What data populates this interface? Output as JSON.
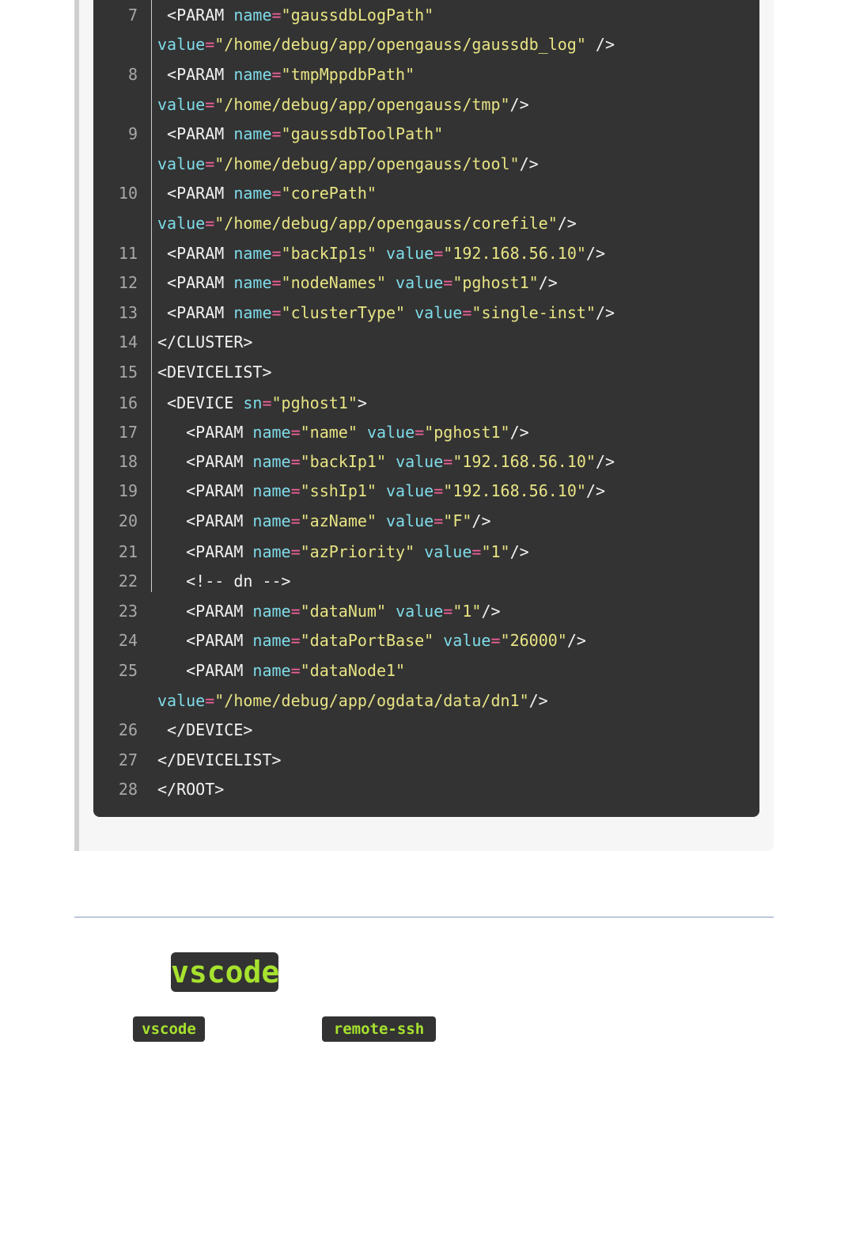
{
  "code_block": {
    "language": "xml",
    "lines": [
      {
        "num": "7",
        "segments": [
          {
            "t": "p",
            "v": " <PARAM "
          },
          {
            "t": "k",
            "v": "name"
          },
          {
            "t": "e",
            "v": "="
          },
          {
            "t": "s",
            "v": "\"gaussdbLogPath\""
          }
        ]
      },
      {
        "num": "",
        "segments": [
          {
            "t": "k",
            "v": "value"
          },
          {
            "t": "e",
            "v": "="
          },
          {
            "t": "s",
            "v": "\"/home/debug/app/opengauss/gaussdb_log\""
          },
          {
            "t": "p",
            "v": " />"
          }
        ]
      },
      {
        "num": "8",
        "segments": [
          {
            "t": "p",
            "v": " <PARAM "
          },
          {
            "t": "k",
            "v": "name"
          },
          {
            "t": "e",
            "v": "="
          },
          {
            "t": "s",
            "v": "\"tmpMppdbPath\""
          }
        ]
      },
      {
        "num": "",
        "segments": [
          {
            "t": "k",
            "v": "value"
          },
          {
            "t": "e",
            "v": "="
          },
          {
            "t": "s",
            "v": "\"/home/debug/app/opengauss/tmp\""
          },
          {
            "t": "p",
            "v": "/>"
          }
        ]
      },
      {
        "num": "9",
        "segments": [
          {
            "t": "p",
            "v": " <PARAM "
          },
          {
            "t": "k",
            "v": "name"
          },
          {
            "t": "e",
            "v": "="
          },
          {
            "t": "s",
            "v": "\"gaussdbToolPath\""
          }
        ]
      },
      {
        "num": "",
        "segments": [
          {
            "t": "k",
            "v": "value"
          },
          {
            "t": "e",
            "v": "="
          },
          {
            "t": "s",
            "v": "\"/home/debug/app/opengauss/tool\""
          },
          {
            "t": "p",
            "v": "/>"
          }
        ]
      },
      {
        "num": "10",
        "segments": [
          {
            "t": "p",
            "v": " <PARAM "
          },
          {
            "t": "k",
            "v": "name"
          },
          {
            "t": "e",
            "v": "="
          },
          {
            "t": "s",
            "v": "\"corePath\""
          }
        ]
      },
      {
        "num": "",
        "segments": [
          {
            "t": "k",
            "v": "value"
          },
          {
            "t": "e",
            "v": "="
          },
          {
            "t": "s",
            "v": "\"/home/debug/app/opengauss/corefile\""
          },
          {
            "t": "p",
            "v": "/>"
          }
        ]
      },
      {
        "num": "11",
        "segments": [
          {
            "t": "p",
            "v": " <PARAM "
          },
          {
            "t": "k",
            "v": "name"
          },
          {
            "t": "e",
            "v": "="
          },
          {
            "t": "s",
            "v": "\"backIp1s\""
          },
          {
            "t": "p",
            "v": " "
          },
          {
            "t": "k",
            "v": "value"
          },
          {
            "t": "e",
            "v": "="
          },
          {
            "t": "s",
            "v": "\"192.168.56.10\""
          },
          {
            "t": "p",
            "v": "/>"
          }
        ]
      },
      {
        "num": "12",
        "segments": [
          {
            "t": "p",
            "v": " <PARAM "
          },
          {
            "t": "k",
            "v": "name"
          },
          {
            "t": "e",
            "v": "="
          },
          {
            "t": "s",
            "v": "\"nodeNames\""
          },
          {
            "t": "p",
            "v": " "
          },
          {
            "t": "k",
            "v": "value"
          },
          {
            "t": "e",
            "v": "="
          },
          {
            "t": "s",
            "v": "\"pghost1\""
          },
          {
            "t": "p",
            "v": "/>"
          }
        ]
      },
      {
        "num": "13",
        "segments": [
          {
            "t": "p",
            "v": " <PARAM "
          },
          {
            "t": "k",
            "v": "name"
          },
          {
            "t": "e",
            "v": "="
          },
          {
            "t": "s",
            "v": "\"clusterType\""
          },
          {
            "t": "p",
            "v": " "
          },
          {
            "t": "k",
            "v": "value"
          },
          {
            "t": "e",
            "v": "="
          },
          {
            "t": "s",
            "v": "\"single-inst\""
          },
          {
            "t": "p",
            "v": "/>"
          }
        ]
      },
      {
        "num": "14",
        "segments": [
          {
            "t": "p",
            "v": "</CLUSTER>"
          }
        ]
      },
      {
        "num": "15",
        "segments": [
          {
            "t": "p",
            "v": "<DEVICELIST>"
          }
        ]
      },
      {
        "num": "16",
        "segments": [
          {
            "t": "p",
            "v": " <DEVICE "
          },
          {
            "t": "k",
            "v": "sn"
          },
          {
            "t": "e",
            "v": "="
          },
          {
            "t": "s",
            "v": "\"pghost1\""
          },
          {
            "t": "p",
            "v": ">"
          }
        ]
      },
      {
        "num": "17",
        "segments": [
          {
            "t": "p",
            "v": "   <PARAM "
          },
          {
            "t": "k",
            "v": "name"
          },
          {
            "t": "e",
            "v": "="
          },
          {
            "t": "s",
            "v": "\"name\""
          },
          {
            "t": "p",
            "v": " "
          },
          {
            "t": "k",
            "v": "value"
          },
          {
            "t": "e",
            "v": "="
          },
          {
            "t": "s",
            "v": "\"pghost1\""
          },
          {
            "t": "p",
            "v": "/>"
          }
        ]
      },
      {
        "num": "18",
        "segments": [
          {
            "t": "p",
            "v": "   <PARAM "
          },
          {
            "t": "k",
            "v": "name"
          },
          {
            "t": "e",
            "v": "="
          },
          {
            "t": "s",
            "v": "\"backIp1\""
          },
          {
            "t": "p",
            "v": " "
          },
          {
            "t": "k",
            "v": "value"
          },
          {
            "t": "e",
            "v": "="
          },
          {
            "t": "s",
            "v": "\"192.168.56.10\""
          },
          {
            "t": "p",
            "v": "/>"
          }
        ]
      },
      {
        "num": "19",
        "segments": [
          {
            "t": "p",
            "v": "   <PARAM "
          },
          {
            "t": "k",
            "v": "name"
          },
          {
            "t": "e",
            "v": "="
          },
          {
            "t": "s",
            "v": "\"sshIp1\""
          },
          {
            "t": "p",
            "v": " "
          },
          {
            "t": "k",
            "v": "value"
          },
          {
            "t": "e",
            "v": "="
          },
          {
            "t": "s",
            "v": "\"192.168.56.10\""
          },
          {
            "t": "p",
            "v": "/>"
          }
        ]
      },
      {
        "num": "20",
        "segments": [
          {
            "t": "p",
            "v": "   <PARAM "
          },
          {
            "t": "k",
            "v": "name"
          },
          {
            "t": "e",
            "v": "="
          },
          {
            "t": "s",
            "v": "\"azName\""
          },
          {
            "t": "p",
            "v": " "
          },
          {
            "t": "k",
            "v": "value"
          },
          {
            "t": "e",
            "v": "="
          },
          {
            "t": "s",
            "v": "\"F\""
          },
          {
            "t": "p",
            "v": "/>"
          }
        ]
      },
      {
        "num": "21",
        "segments": [
          {
            "t": "p",
            "v": "   <PARAM "
          },
          {
            "t": "k",
            "v": "name"
          },
          {
            "t": "e",
            "v": "="
          },
          {
            "t": "s",
            "v": "\"azPriority\""
          },
          {
            "t": "p",
            "v": " "
          },
          {
            "t": "k",
            "v": "value"
          },
          {
            "t": "e",
            "v": "="
          },
          {
            "t": "s",
            "v": "\"1\""
          },
          {
            "t": "p",
            "v": "/>"
          }
        ]
      },
      {
        "num": "22",
        "segments": [
          {
            "t": "p",
            "v": "   <!-- dn -->"
          }
        ]
      },
      {
        "num": "23",
        "segments": [
          {
            "t": "p",
            "v": "   <PARAM "
          },
          {
            "t": "k",
            "v": "name"
          },
          {
            "t": "e",
            "v": "="
          },
          {
            "t": "s",
            "v": "\"dataNum\""
          },
          {
            "t": "p",
            "v": " "
          },
          {
            "t": "k",
            "v": "value"
          },
          {
            "t": "e",
            "v": "="
          },
          {
            "t": "s",
            "v": "\"1\""
          },
          {
            "t": "p",
            "v": "/>"
          }
        ]
      },
      {
        "num": "24",
        "segments": [
          {
            "t": "p",
            "v": "   <PARAM "
          },
          {
            "t": "k",
            "v": "name"
          },
          {
            "t": "e",
            "v": "="
          },
          {
            "t": "s",
            "v": "\"dataPortBase\""
          },
          {
            "t": "p",
            "v": " "
          },
          {
            "t": "k",
            "v": "value"
          },
          {
            "t": "e",
            "v": "="
          },
          {
            "t": "s",
            "v": "\"26000\""
          },
          {
            "t": "p",
            "v": "/>"
          }
        ]
      },
      {
        "num": "25",
        "segments": [
          {
            "t": "p",
            "v": "   <PARAM "
          },
          {
            "t": "k",
            "v": "name"
          },
          {
            "t": "e",
            "v": "="
          },
          {
            "t": "s",
            "v": "\"dataNode1\""
          }
        ]
      },
      {
        "num": "",
        "segments": [
          {
            "t": "k",
            "v": "value"
          },
          {
            "t": "e",
            "v": "="
          },
          {
            "t": "s",
            "v": "\"/home/debug/app/ogdata/data/dn1\""
          },
          {
            "t": "p",
            "v": "/>"
          }
        ]
      },
      {
        "num": "26",
        "segments": [
          {
            "t": "p",
            "v": " </DEVICE>"
          }
        ]
      },
      {
        "num": "27",
        "segments": [
          {
            "t": "p",
            "v": "</DEVICELIST>"
          }
        ]
      },
      {
        "num": "28",
        "segments": [
          {
            "t": "p",
            "v": "</ROOT>"
          }
        ]
      }
    ]
  },
  "heading": {
    "title": "vscode"
  },
  "tags": {
    "first": "vscode",
    "second": "remote-ssh"
  },
  "colors": {
    "code_background": "#333333",
    "tag_text": "#a6e22e",
    "attribute": "#7fdcea",
    "string": "#e8e484",
    "equals": "#f0619a"
  }
}
